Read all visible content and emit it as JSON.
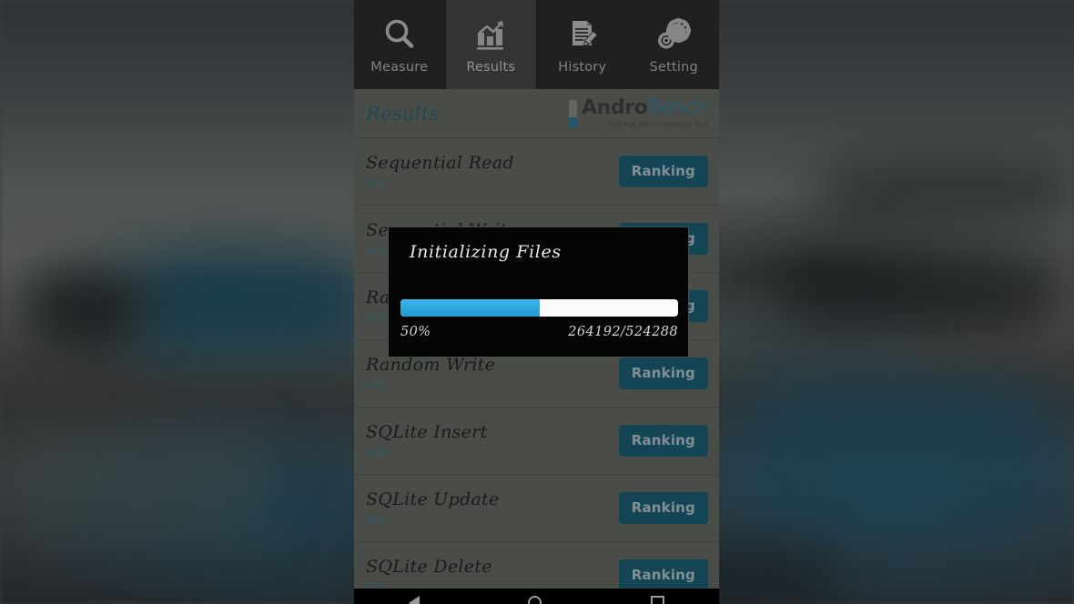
{
  "app": {
    "name": "AndroBench",
    "logo": {
      "word_part_1": "Andro",
      "word_part_2": "Bench",
      "subtitle": "Storage Benchmarking Tool"
    },
    "accent_color": "#1d6479",
    "progress_color": "#2ba6dc",
    "value_color": "#3f7f90"
  },
  "tabs": [
    {
      "label": "Measure",
      "icon": "magnifier-icon",
      "active": false
    },
    {
      "label": "Results",
      "icon": "bar-chart-icon",
      "active": true
    },
    {
      "label": "History",
      "icon": "document-pencil-icon",
      "active": false
    },
    {
      "label": "Setting",
      "icon": "gears-icon",
      "active": false
    }
  ],
  "header": {
    "title": "Results"
  },
  "results": {
    "button_label": "Ranking",
    "rows": [
      {
        "name": "Sequential Read",
        "value": "n/a"
      },
      {
        "name": "Sequential Write",
        "value": "n/a"
      },
      {
        "name": "Random Read",
        "value": "n/a"
      },
      {
        "name": "Random Write",
        "value": "n/a"
      },
      {
        "name": "SQLite Insert",
        "value": "n/a"
      },
      {
        "name": "SQLite Update",
        "value": "n/a"
      },
      {
        "name": "SQLite Delete",
        "value": "n/a"
      }
    ]
  },
  "dialog": {
    "title": "Initializing Files",
    "percent_label": "50%",
    "percent_value": 50,
    "count_label": "264192/524288"
  },
  "navbar": {
    "back": "back-triangle-icon",
    "home": "home-circle-icon",
    "recents": "recents-square-icon"
  }
}
